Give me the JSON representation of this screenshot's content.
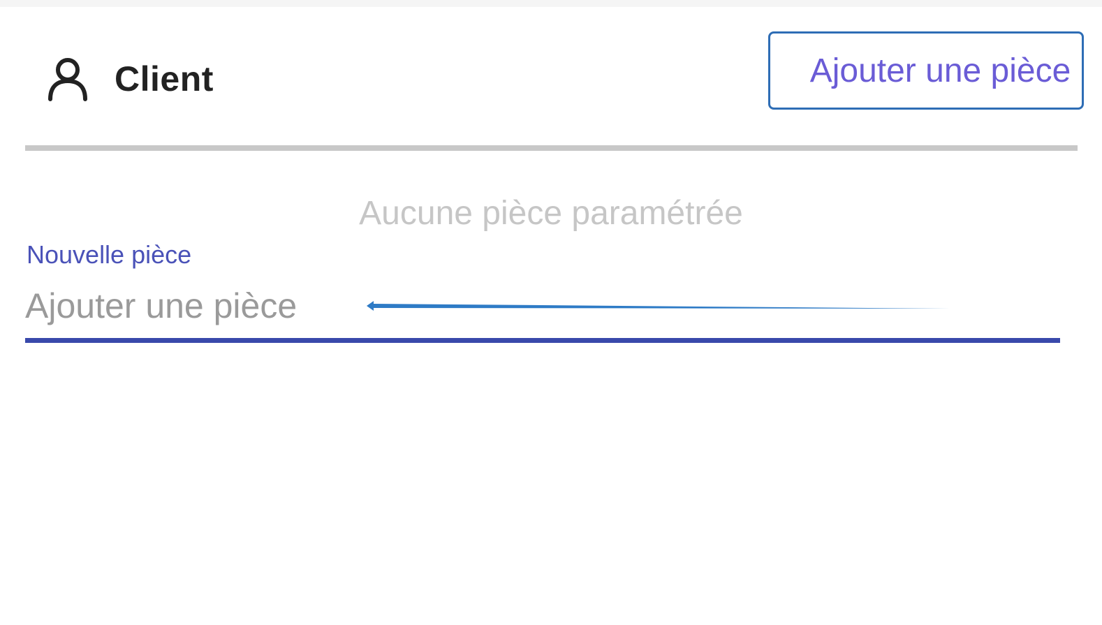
{
  "header": {
    "icon": "user-icon",
    "title": "Client"
  },
  "actions": {
    "add_room_label": "Ajouter une pièce"
  },
  "rooms": {
    "empty_message": "Aucune pièce paramétrée"
  },
  "new_room_field": {
    "label": "Nouvelle pièce",
    "placeholder": "Ajouter une pièce",
    "value": ""
  },
  "annotation": {
    "icon": "arrow-left-icon",
    "color": "#2e7bc6"
  },
  "colors": {
    "accent": "#3949ab",
    "button_border": "#2e6db5",
    "button_text": "#6a5cd6"
  }
}
